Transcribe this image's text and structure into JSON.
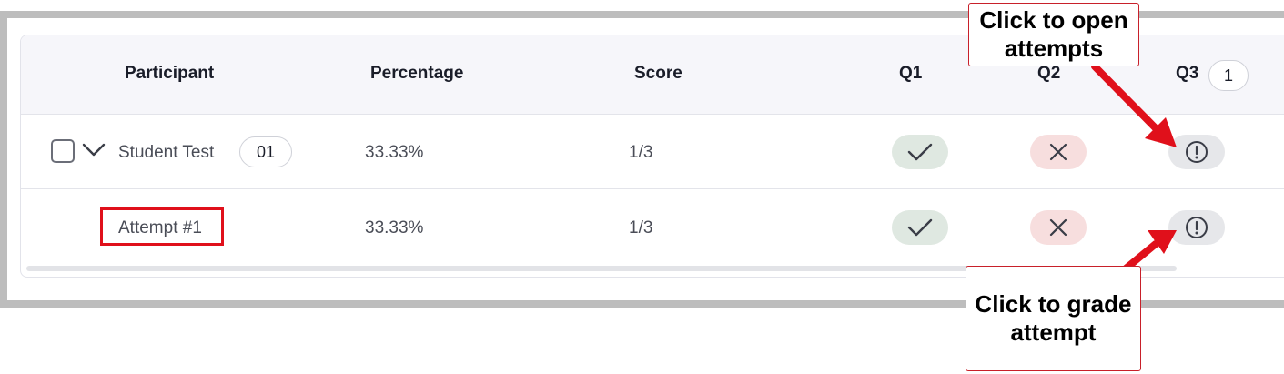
{
  "table": {
    "headers": {
      "participant": "Participant",
      "percentage": "Percentage",
      "score": "Score",
      "q1": "Q1",
      "q2": "Q2",
      "q3": "Q3",
      "q3_badge": "1"
    },
    "rows": [
      {
        "name": "Student Test",
        "attempt_count": "01",
        "percentage": "33.33%",
        "score": "1/3",
        "q1": "correct",
        "q2": "incorrect",
        "q3": "needs-grading"
      },
      {
        "name": "Attempt #1",
        "percentage": "33.33%",
        "score": "1/3",
        "q1": "correct",
        "q2": "incorrect",
        "q3": "needs-grading"
      }
    ]
  },
  "callouts": {
    "open_attempts": "Click to open attempts",
    "grade_attempt": "Click to grade attempt"
  },
  "icons": {
    "q1": "check-icon",
    "q2": "x-icon",
    "q3": "exclamation-circle-icon",
    "expand": "chevron-down-icon"
  },
  "colors": {
    "annotation_red": "#e0101b",
    "correct_bg": "#dfe8e1",
    "incorrect_bg": "#f7dede",
    "pending_bg": "#e6e7ea"
  }
}
